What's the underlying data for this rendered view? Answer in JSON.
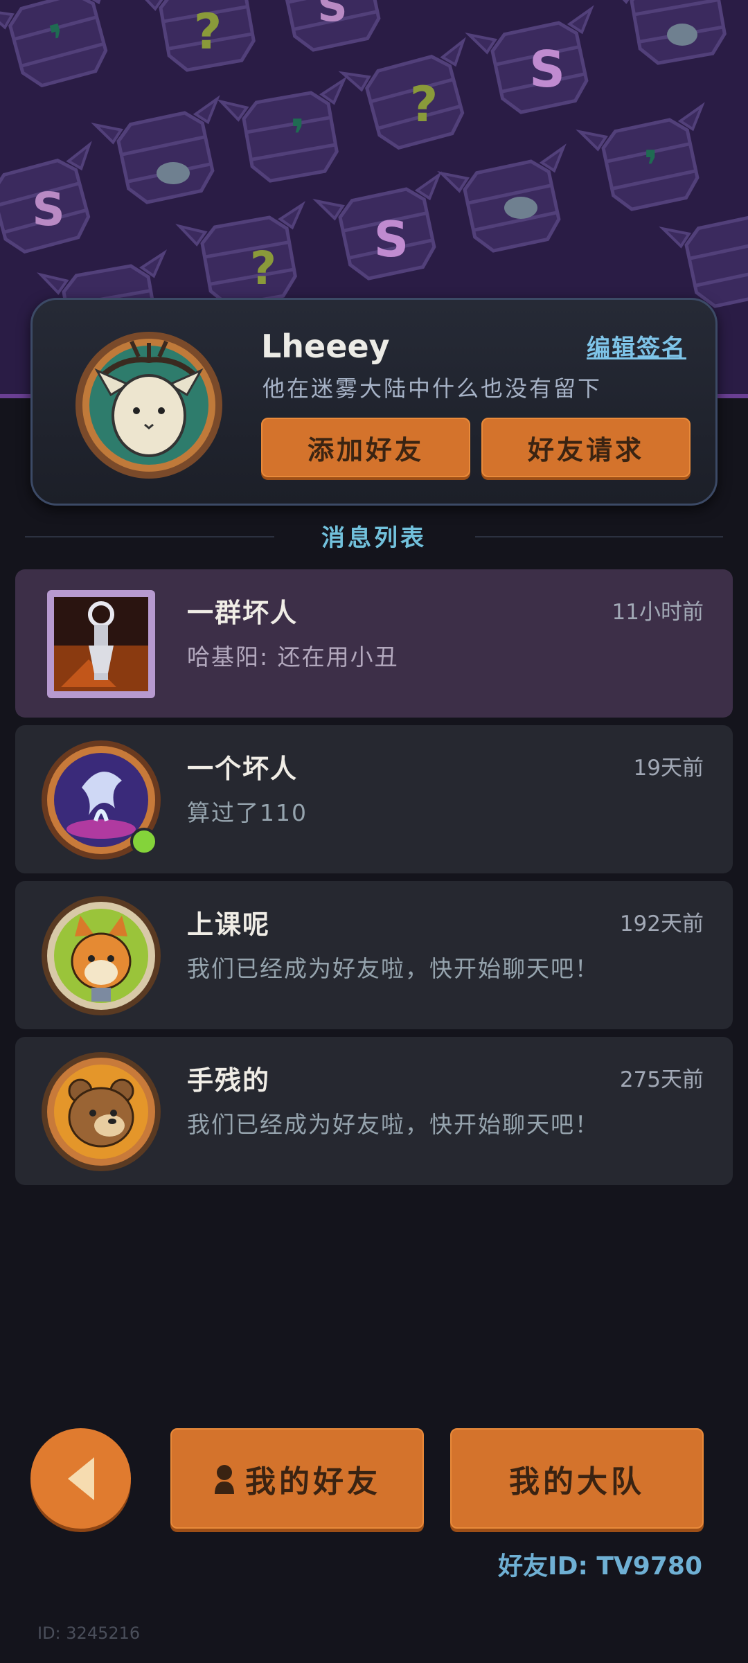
{
  "profile": {
    "name": "Lheeey",
    "edit_sign_label": "编辑签名",
    "signature": "他在迷雾大陆中什么也没有留下",
    "add_friend_label": "添加好友",
    "friend_request_label": "好友请求"
  },
  "section_title": "消息列表",
  "messages": [
    {
      "name": "一群坏人",
      "time": "11小时前",
      "preview": "哈基阳: 还在用小丑",
      "avatar": "group-castle-icon"
    },
    {
      "name": "一个坏人",
      "time": "19天前",
      "preview": "算过了110",
      "avatar": "purple-dragon-avatar",
      "online": true
    },
    {
      "name": "上课呢",
      "time": "192天前",
      "preview": "我们已经成为好友啦，快开始聊天吧！",
      "avatar": "fox-avatar"
    },
    {
      "name": "手残的",
      "time": "275天前",
      "preview": "我们已经成为好友啦，快开始聊天吧！",
      "avatar": "bear-avatar"
    }
  ],
  "nav": {
    "my_friends_label": "我的好友",
    "my_team_label": "我的大队"
  },
  "friend_id": "好友ID: TV9780",
  "user_id": "ID: 3245216",
  "colors": {
    "accent_orange": "#d4732c",
    "banner_purple": "#2a1c45",
    "link_blue": "#7ec4e8",
    "online_green": "#84d33a"
  }
}
